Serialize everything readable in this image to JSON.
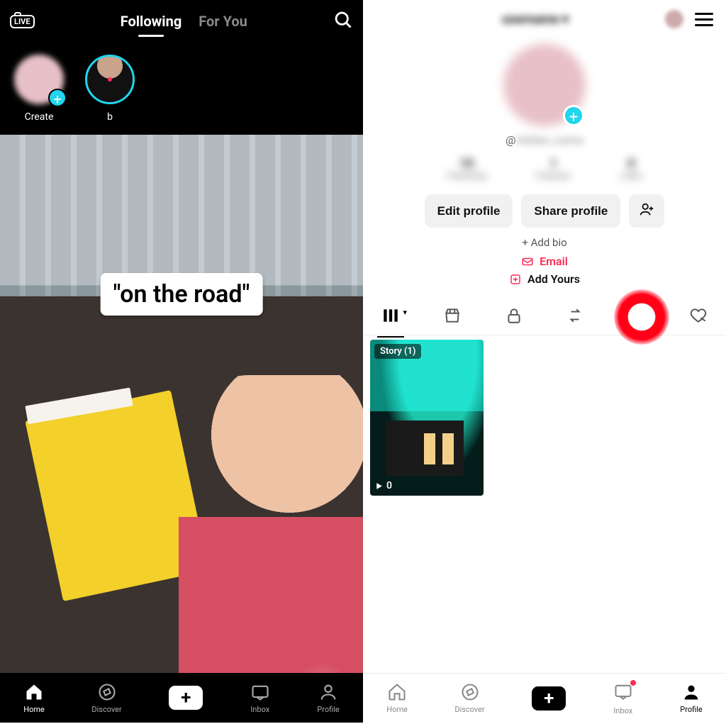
{
  "left": {
    "header": {
      "live_label": "LIVE",
      "tab_following": "Following",
      "tab_foryou": "For You"
    },
    "stories": {
      "create_label": "Create",
      "item_b_label": "b"
    },
    "video": {
      "caption": "\"on the road\""
    },
    "nav": {
      "home": "Home",
      "discover": "Discover",
      "inbox": "Inbox",
      "profile": "Profile"
    }
  },
  "right": {
    "handle_prefix": "@",
    "stats": {
      "following_n": "10",
      "following_l": "Following",
      "followers_n": "1",
      "followers_l": "Follower",
      "likes_n": "0",
      "likes_l": "Likes"
    },
    "buttons": {
      "edit": "Edit profile",
      "share": "Share profile"
    },
    "links": {
      "add_bio": "+ Add bio",
      "email": "Email",
      "add_yours": "Add Yours"
    },
    "story_thumb": {
      "badge": "Story (1)",
      "plays": "0"
    },
    "nav": {
      "home": "Home",
      "discover": "Discover",
      "inbox": "Inbox",
      "profile": "Profile"
    }
  }
}
